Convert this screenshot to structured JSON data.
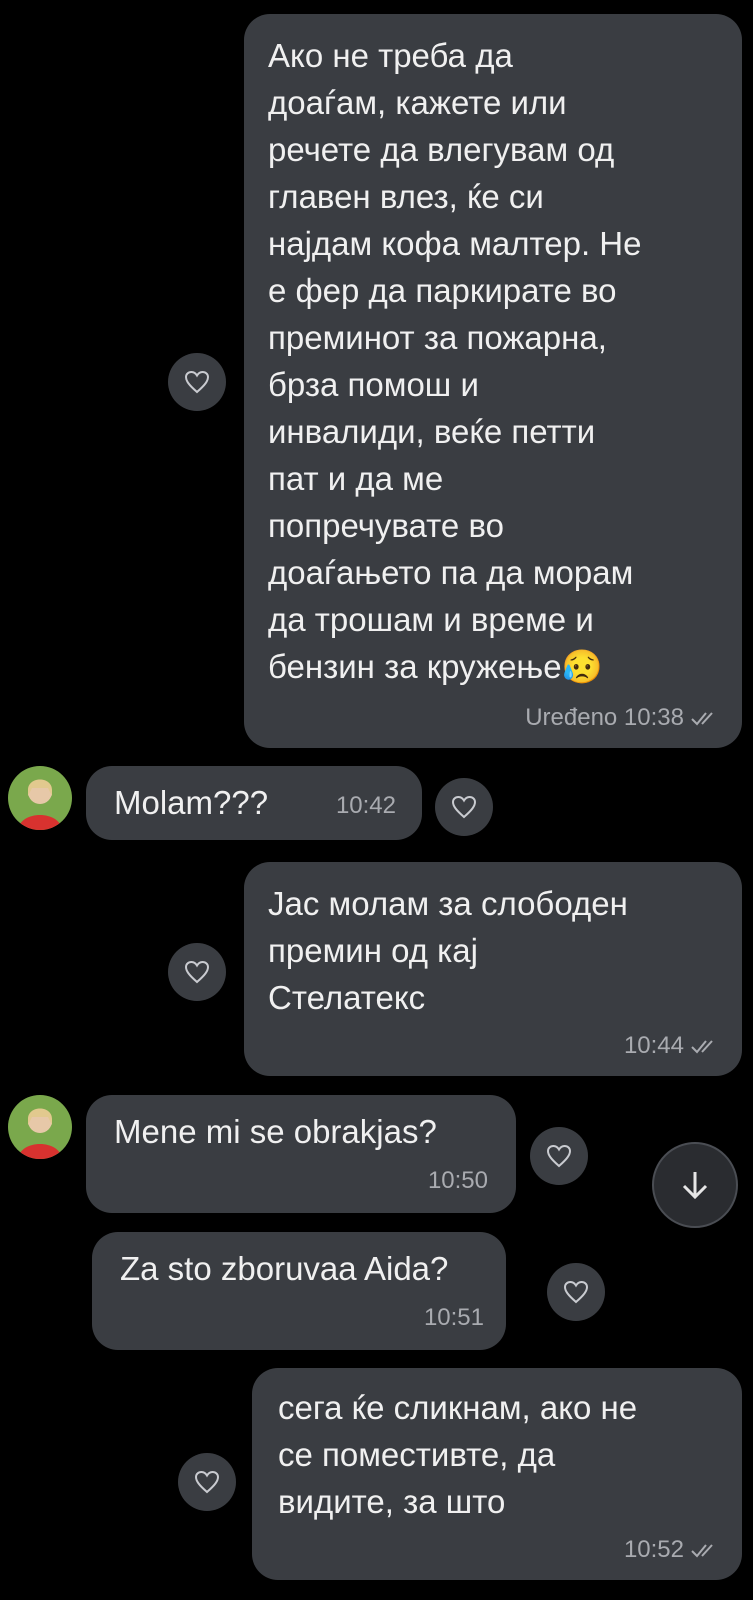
{
  "colors": {
    "background": "#000000",
    "bubble": "#3a3d42",
    "text": "#f0f0f0",
    "meta": "#a9abb0"
  },
  "messages": [
    {
      "direction": "outgoing",
      "text": "Ако не треба да\nдоаѓам, кажете или\nречете да влегувам од\nглавен влез, ќе си\nнајдам кофа малтер. Не\nе фер да паркирате во\nпреминот за пожарна,\nбрза помош и\nинвалиди, веќе петти\nпат и да ме\nпопречувате во\nдоаѓањето па да морам\nда трошам и време и\nбензин за кружење😥",
      "time": "Uređeno 10:38",
      "read_receipt": "double-check-icon"
    },
    {
      "direction": "incoming",
      "text": "Molam???",
      "time": "10:42"
    },
    {
      "direction": "outgoing",
      "text": "Јас молам за слободен\nпремин од кај\nСтелатекс",
      "time": "10:44",
      "read_receipt": "double-check-icon"
    },
    {
      "direction": "incoming",
      "text": "Mene mi se obrakjas?",
      "time": "10:50"
    },
    {
      "direction": "incoming",
      "text": "Za sto zboruvaa Aida?",
      "time": "10:51"
    },
    {
      "direction": "outgoing",
      "text": "сега ќе сликнам, ако не\nсе поместивте, да\nвидите, за што",
      "time": "10:52",
      "read_receipt": "double-check-icon"
    }
  ],
  "icons": {
    "react": "heart-outline-icon",
    "scroll": "arrow-down-icon",
    "avatar": "contact-avatar"
  }
}
